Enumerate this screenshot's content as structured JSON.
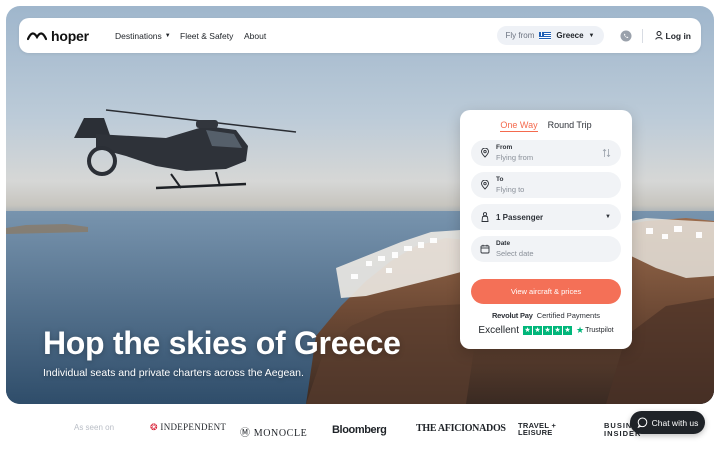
{
  "nav": {
    "brand": "hoper",
    "links": [
      {
        "label": "Destinations",
        "has_dropdown": true
      },
      {
        "label": "Fleet & Safety"
      },
      {
        "label": "About"
      }
    ],
    "fly_from_label": "Fly from",
    "fly_from_country": "Greece",
    "login_label": "Log in"
  },
  "hero": {
    "headline": "Hop the skies of Greece",
    "subline": "Individual seats and private charters across the Aegean."
  },
  "booking": {
    "tabs": [
      {
        "label": "One Way",
        "active": true
      },
      {
        "label": "Round Trip",
        "active": false
      }
    ],
    "from": {
      "label": "From",
      "placeholder": "Flying from"
    },
    "to": {
      "label": "To",
      "placeholder": "Flying to"
    },
    "passengers": "1 Passenger",
    "date": {
      "label": "Date",
      "placeholder": "Select date"
    },
    "cta": "View aircraft & prices",
    "payment_brand": "Revolut Pay",
    "payment_text": "Certified Payments",
    "rating_text": "Excellent",
    "rating_provider": "Trustpilot",
    "rating_stars": 5
  },
  "press": {
    "label": "As seen on",
    "logos": [
      "INDEPENDENT",
      "MONOCLE",
      "Bloomberg",
      "THE AFICIONADOS",
      "TRAVEL + LEISURE",
      "BUSINESS INSIDER"
    ]
  },
  "chat": {
    "label": "Chat with us"
  },
  "colors": {
    "accent": "#f46a4e",
    "trustpilot": "#00b67a",
    "dark": "#1f2328"
  }
}
